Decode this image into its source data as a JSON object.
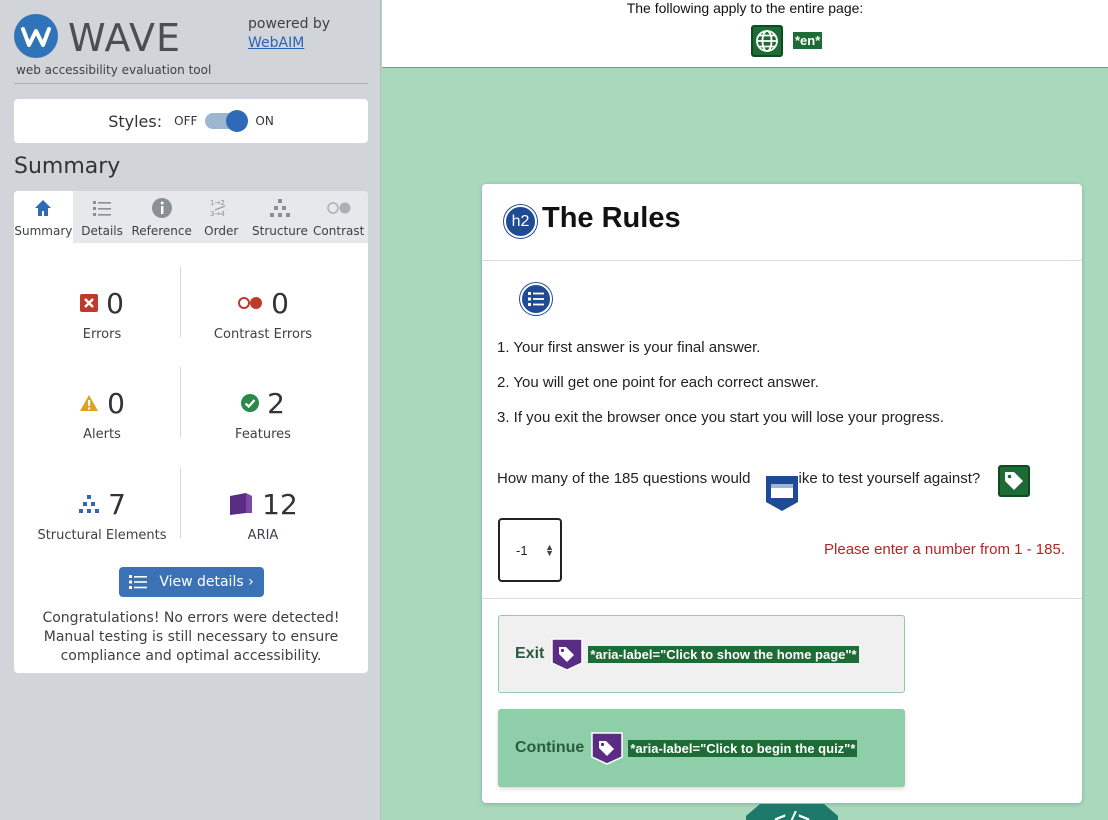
{
  "wave": {
    "logo_text": "WAVE",
    "tagline": "web accessibility evaluation tool",
    "powered_by": "powered by",
    "webaim_link": "WebAIM",
    "styles_label": "Styles:",
    "styles_off": "OFF",
    "styles_on": "ON",
    "styles_state": "on",
    "summary_title": "Summary",
    "tabs": [
      {
        "label": "Summary",
        "icon": "home-icon",
        "active": true
      },
      {
        "label": "Details",
        "icon": "details-list-icon"
      },
      {
        "label": "Reference",
        "icon": "info-icon"
      },
      {
        "label": "Order",
        "icon": "order-icon"
      },
      {
        "label": "Structure",
        "icon": "structure-icon"
      },
      {
        "label": "Contrast",
        "icon": "contrast-icon"
      }
    ],
    "stats": [
      {
        "count": "0",
        "label": "Errors",
        "icon": "error-icon",
        "color": "#c0392b"
      },
      {
        "count": "0",
        "label": "Contrast Errors",
        "icon": "contrast-error-icon",
        "color": "#c0392b"
      },
      {
        "count": "0",
        "label": "Alerts",
        "icon": "alert-icon",
        "color": "#e0a020"
      },
      {
        "count": "2",
        "label": "Features",
        "icon": "feature-icon",
        "color": "#2a8a4a"
      },
      {
        "count": "7",
        "label": "Structural Elements",
        "icon": "structural-icon",
        "color": "#2f6ab7"
      },
      {
        "count": "12",
        "label": "ARIA",
        "icon": "aria-icon",
        "color": "#5b2c83"
      }
    ],
    "view_details": "View details ›",
    "congrats": "Congratulations! No errors were detected! Manual testing is still necessary to ensure compliance and optimal accessibility."
  },
  "page": {
    "top_message": "The following apply to the entire page:",
    "lang_tag": "*en*",
    "heading_badge": "h2",
    "heading": "The Rules",
    "rules": [
      "1. Your first answer is your final answer.",
      "2. You will get one point for each correct answer.",
      "3. If you exit the browser once you start you will lose your progress."
    ],
    "question": "How many of the 185 questions would you like to test yourself against?",
    "question_left": "How many of the 185 questions would",
    "question_right": "ike to test yourself against?",
    "number_value": "-1",
    "error_message": "Please enter a number from 1 - 185.",
    "exit_label": "Exit",
    "exit_aria": "*aria-label=\"Click to show the home page\"*",
    "continue_label": "Continue",
    "continue_aria": "*aria-label=\"Click to begin the quiz\"*"
  },
  "colors": {
    "page_bg": "#a9d8bd",
    "sidebar_bg": "#d1d5da",
    "wave_blue": "#2f73b8",
    "feature_green": "#1d6b35",
    "structure_blue": "#1f4b94",
    "aria_purple": "#5b2c83",
    "error_red": "#b52424"
  }
}
